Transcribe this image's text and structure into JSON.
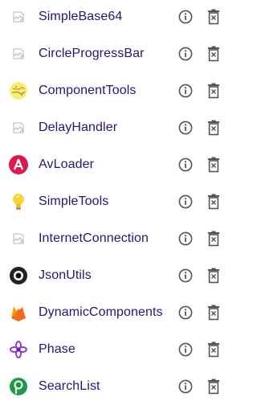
{
  "colors": {
    "link": "#23167a",
    "action_icon": "#555555",
    "placeholder_icon": "#b5b5b5"
  },
  "libraries": [
    {
      "name": "SimpleBase64",
      "icon": "broken-image-icon"
    },
    {
      "name": "CircleProgressBar",
      "icon": "broken-image-icon"
    },
    {
      "name": "ComponentTools",
      "icon": "componenttools-logo-icon"
    },
    {
      "name": "DelayHandler",
      "icon": "broken-image-icon"
    },
    {
      "name": "AvLoader",
      "icon": "avloader-logo-icon"
    },
    {
      "name": "SimpleTools",
      "icon": "lightbulb-icon"
    },
    {
      "name": "InternetConnection",
      "icon": "broken-image-icon"
    },
    {
      "name": "JsonUtils",
      "icon": "jsonutils-logo-icon"
    },
    {
      "name": "DynamicComponents",
      "icon": "firebase-flame-icon"
    },
    {
      "name": "Phase",
      "icon": "phase-flower-icon"
    },
    {
      "name": "SearchList",
      "icon": "searchlist-logo-icon"
    }
  ],
  "actions": {
    "info_icon": "info-circle-icon",
    "delete_icon": "trash-icon"
  }
}
